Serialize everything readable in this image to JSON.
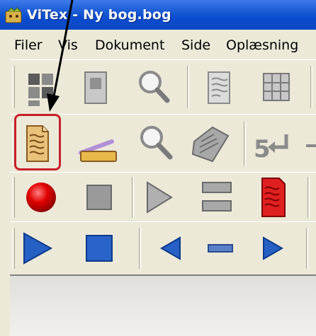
{
  "window": {
    "title": "ViTex - Ny bog.bog"
  },
  "menu": [
    "Filer",
    "Vis",
    "Dokument",
    "Side",
    "Oplæsning"
  ],
  "toolbar1": [
    "layout-grid-icon",
    "page-view-icon",
    "magnifier-icon",
    "page-text-icon",
    "table-grid-icon"
  ],
  "toolbar2": [
    "document-icon",
    "scanner-icon",
    "magnifier-icon",
    "scanned-pages-icon",
    "page-break-icon"
  ],
  "toolbar3": [
    "record-icon",
    "stop-icon",
    "play-icon",
    "lines-icon",
    "red-document-icon"
  ],
  "toolbar4": [
    "play-icon",
    "stop-icon",
    "previous-icon",
    "dash-icon",
    "next-icon"
  ],
  "colors": {
    "title_bar": "#0a4cd0",
    "highlight": "#c8202a",
    "play": "#2660c5",
    "record": "#e00000"
  }
}
